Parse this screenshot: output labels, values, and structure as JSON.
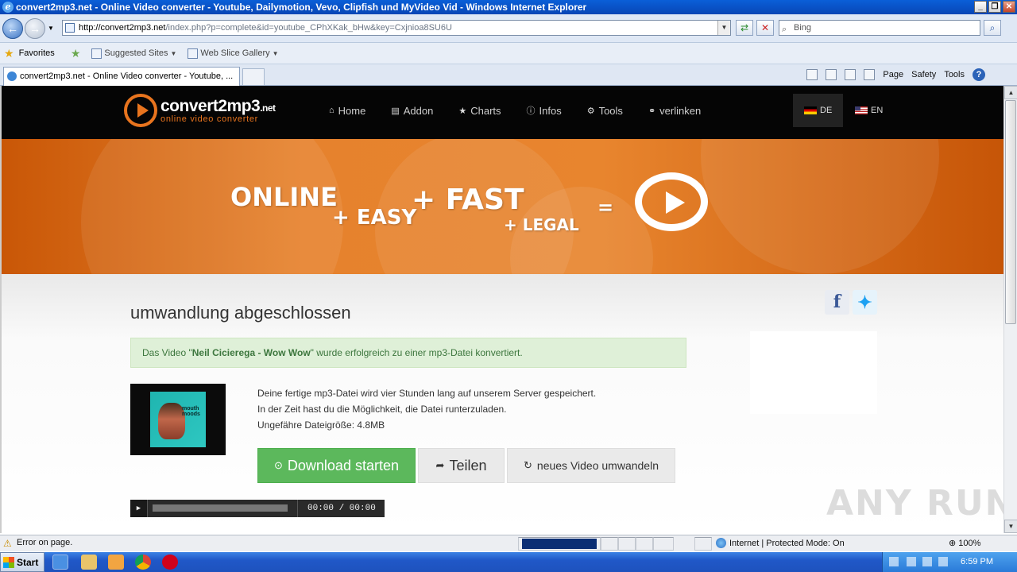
{
  "window": {
    "title": "convert2mp3.net - Online Video converter - Youtube, Dailymotion, Vevo, Clipfish und MyVideo Vid - Windows Internet Explorer"
  },
  "browser": {
    "address_host": "http://convert2mp3.net",
    "address_rest": "/index.php?p=complete&id=youtube_CPhXKak_bHw&key=Cxjnioa8SU6U",
    "search_placeholder": "Bing",
    "favorites_label": "Favorites",
    "suggested_sites": "Suggested Sites",
    "web_slice_gallery": "Web Slice Gallery",
    "tab_title": "convert2mp3.net - Online Video converter - Youtube, ...",
    "cmd_page": "Page",
    "cmd_safety": "Safety",
    "cmd_tools": "Tools"
  },
  "site": {
    "logo_name": "convert2mp3",
    "logo_tld": ".net",
    "logo_tagline": "online video converter",
    "nav": [
      {
        "label": "Home",
        "icon": "home-icon"
      },
      {
        "label": "Addon",
        "icon": "document-icon"
      },
      {
        "label": "Charts",
        "icon": "star-icon"
      },
      {
        "label": "Infos",
        "icon": "info-icon"
      },
      {
        "label": "Tools",
        "icon": "gears-icon"
      },
      {
        "label": "verlinken",
        "icon": "link-icon"
      }
    ],
    "lang_de": "DE",
    "lang_en": "EN"
  },
  "banner": {
    "online": "ONLINE",
    "easy": "+ EASY",
    "fast": "+ FAST",
    "legal": "+ LEGAL",
    "equals": "="
  },
  "main": {
    "heading": "umwandlung abgeschlossen",
    "alert_pre": "Das Video \"",
    "alert_video": "Neil Cicierega - Wow Wow",
    "alert_post": "\" wurde erfolgreich zu einer mp3-Datei konvertiert.",
    "info_line1": "Deine fertige mp3-Datei wird vier Stunden lang auf unserem Server gespeichert.",
    "info_line2": "In der Zeit hast du die Möglichkeit, die Datei runterzuladen.",
    "info_line3": "Ungefähre Dateigröße: 4.8MB",
    "download_label": "Download starten",
    "share_label": "Teilen",
    "convert_label": "neues Video umwandeln",
    "player_time": "00:00 / 00:00",
    "cover_text": "mouth moods"
  },
  "statusbar": {
    "error": "Error on page.",
    "zone": "Internet | Protected Mode: On",
    "zoom": "100%"
  },
  "taskbar": {
    "start": "Start",
    "clock": "6:59 PM"
  },
  "watermark": "ANY RUN",
  "colors": {
    "accent_orange": "#e8741e",
    "download_green": "#5cb85c",
    "alert_bg": "#dff0d8",
    "nav_bg": "#050505"
  }
}
